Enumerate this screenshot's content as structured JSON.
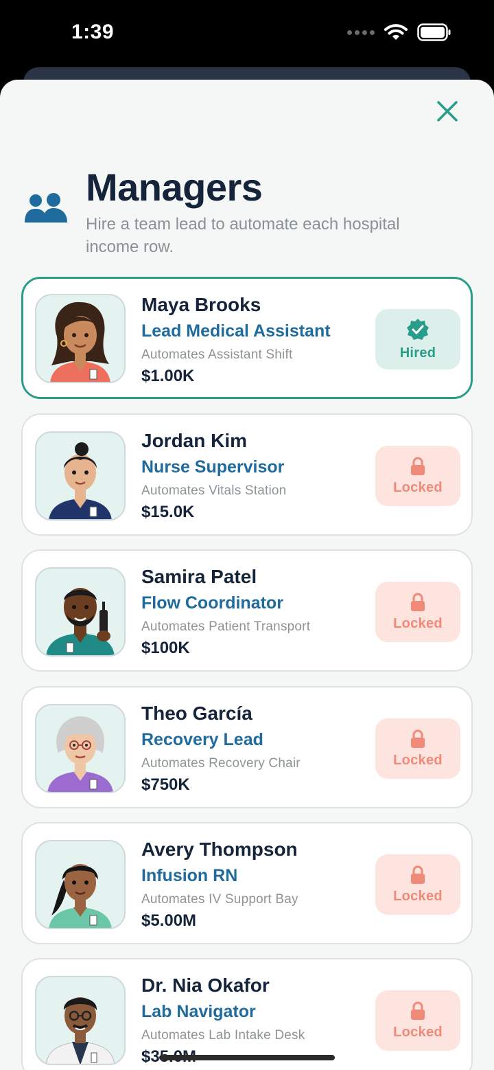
{
  "status_bar": {
    "time": "1:39"
  },
  "header": {
    "title": "Managers",
    "subtitle": "Hire a team lead to automate each hospital income row."
  },
  "colors": {
    "accent": "#2a9d8a",
    "title": "#15243b",
    "role": "#1f6b9e",
    "locked_bg": "#fde4df",
    "locked_fg": "#f08a78"
  },
  "managers": [
    {
      "name": "Maya Brooks",
      "role": "Lead Medical Assistant",
      "automates": "Automates Assistant Shift",
      "cost": "$1.00K",
      "state": "Hired",
      "icon": "verified-badge-icon"
    },
    {
      "name": "Jordan Kim",
      "role": "Nurse Supervisor",
      "automates": "Automates Vitals Station",
      "cost": "$15.0K",
      "state": "Locked",
      "icon": "lock-icon"
    },
    {
      "name": "Samira Patel",
      "role": "Flow Coordinator",
      "automates": "Automates Patient Transport",
      "cost": "$100K",
      "state": "Locked",
      "icon": "lock-icon"
    },
    {
      "name": "Theo García",
      "role": "Recovery Lead",
      "automates": "Automates Recovery Chair",
      "cost": "$750K",
      "state": "Locked",
      "icon": "lock-icon"
    },
    {
      "name": "Avery Thompson",
      "role": "Infusion RN",
      "automates": "Automates IV Support Bay",
      "cost": "$5.00M",
      "state": "Locked",
      "icon": "lock-icon"
    },
    {
      "name": "Dr. Nia Okafor",
      "role": "Lab Navigator",
      "automates": "Automates Lab Intake Desk",
      "cost": "$35.0M",
      "state": "Locked",
      "icon": "lock-icon"
    }
  ]
}
